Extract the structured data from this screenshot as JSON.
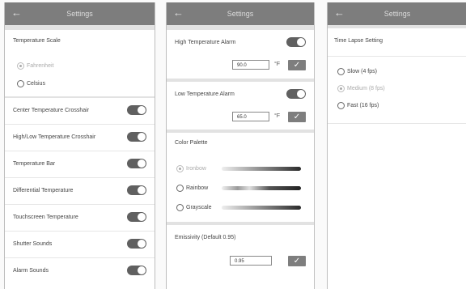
{
  "screen1": {
    "title": "Settings",
    "temperature_scale": {
      "label": "Temperature Scale",
      "options": [
        "Fahrenheit",
        "Celsius"
      ],
      "selected": "Fahrenheit"
    },
    "toggles": [
      {
        "label": "Center Temperature Crosshair",
        "on": true
      },
      {
        "label": "High/Low Temperature Crosshair",
        "on": true
      },
      {
        "label": "Temperature Bar",
        "on": true
      },
      {
        "label": "Differential Temperature",
        "on": true
      },
      {
        "label": "Touchscreen Temperature",
        "on": true
      },
      {
        "label": "Shutter Sounds",
        "on": true
      },
      {
        "label": "Alarm Sounds",
        "on": true
      }
    ]
  },
  "screen2": {
    "title": "Settings",
    "high_alarm": {
      "label": "High Temperature Alarm",
      "on": true,
      "value": "90.0",
      "unit": "°F"
    },
    "low_alarm": {
      "label": "Low Temperature Alarm",
      "on": true,
      "value": "65.0",
      "unit": "°F"
    },
    "color_palette": {
      "label": "Color Palette",
      "options": [
        "Ironbow",
        "Rainbow",
        "Grayscale"
      ],
      "selected": "Ironbow"
    },
    "emissivity": {
      "label": "Emissivity (Default 0.95)",
      "value": "0.95"
    },
    "check_glyph": "✓"
  },
  "screen3": {
    "title": "Settings",
    "time_lapse": {
      "label": "Time Lapse Setting",
      "options": [
        "Slow (4 fps)",
        "Medium (8 fps)",
        "Fast (16 fps)"
      ],
      "selected": "Medium (8 fps)"
    }
  },
  "icons": {
    "back": "←",
    "check": "check-icon",
    "toggle": "toggle-switch"
  }
}
